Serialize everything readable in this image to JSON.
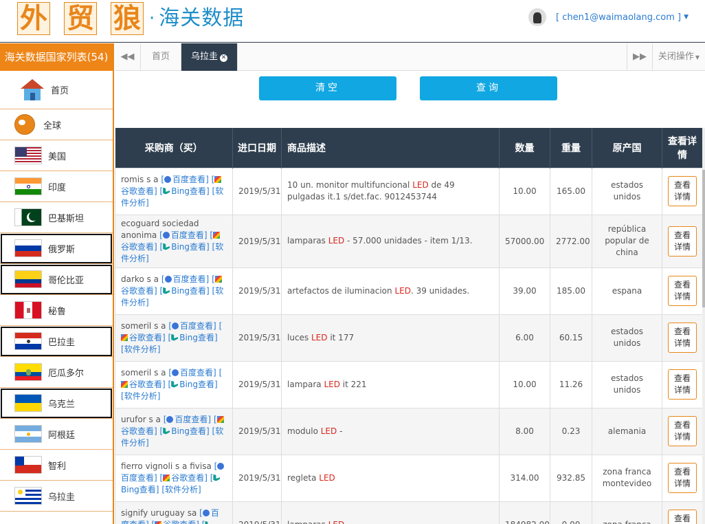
{
  "header": {
    "logo_chars": [
      "外",
      "贸",
      "狼"
    ],
    "logo_dot": "·",
    "logo_sub": "海关数据",
    "user_email": "[ chen1@waimaolang.com ]"
  },
  "sidebar": {
    "title": "海关数据国家列表(54)",
    "home": "首页",
    "global": "全球",
    "countries": [
      {
        "label": "美国",
        "flag": "us",
        "boxed": false
      },
      {
        "label": "印度",
        "flag": "in",
        "boxed": false
      },
      {
        "label": "巴基斯坦",
        "flag": "pk",
        "boxed": false
      },
      {
        "label": "俄罗斯",
        "flag": "ru",
        "boxed": true
      },
      {
        "label": "哥伦比亚",
        "flag": "co",
        "boxed": true
      },
      {
        "label": "秘鲁",
        "flag": "pe",
        "boxed": false
      },
      {
        "label": "巴拉圭",
        "flag": "py",
        "boxed": true
      },
      {
        "label": "厄瓜多尔",
        "flag": "ec",
        "boxed": false
      },
      {
        "label": "乌克兰",
        "flag": "ua",
        "boxed": true
      },
      {
        "label": "阿根廷",
        "flag": "ar",
        "boxed": false
      },
      {
        "label": "智利",
        "flag": "cl",
        "boxed": false
      },
      {
        "label": "乌拉圭",
        "flag": "uy",
        "boxed": false
      }
    ]
  },
  "tabs": {
    "back": "◀◀",
    "home": "首页",
    "active": "乌拉圭",
    "forward": "▶▶",
    "close_ops": "关闭操作"
  },
  "buttons": {
    "clear": "清空",
    "query": "查询"
  },
  "table": {
    "headers": [
      "采购商（买）",
      "进口日期",
      "商品描述",
      "数量",
      "重量",
      "原产国",
      "查看详情"
    ],
    "link_baidu": "百度查看",
    "link_google": "谷歌查看",
    "link_bing": "Bing查看",
    "link_analysis": "软件分析",
    "detail_label": "查看详情",
    "rows": [
      {
        "buyer": "romis s a",
        "date": "2019/5/31",
        "desc_pre": "10 un. monitor multifuncional ",
        "desc_hl": "LED",
        "desc_post": " de 49 pulgadas it.1 s/det.fac. 9012453744",
        "qty": "10.00",
        "weight": "165.00",
        "origin": "estados unidos"
      },
      {
        "buyer": "ecoguard sociedad anonima",
        "date": "2019/5/31",
        "desc_pre": "lamparas ",
        "desc_hl": "LED",
        "desc_post": " - 57.000 unidades - item 1/13.",
        "qty": "57000.00",
        "weight": "2772.00",
        "origin": "república popular de china"
      },
      {
        "buyer": "darko s a",
        "date": "2019/5/31",
        "desc_pre": "artefactos de iluminacion ",
        "desc_hl": "LED",
        "desc_post": ". 39 unidades.",
        "qty": "39.00",
        "weight": "185.00",
        "origin": "espana"
      },
      {
        "buyer": "someril s a",
        "date": "2019/5/31",
        "desc_pre": "luces ",
        "desc_hl": "LED",
        "desc_post": " it 177",
        "qty": "6.00",
        "weight": "60.15",
        "origin": "estados unidos"
      },
      {
        "buyer": "someril s a",
        "date": "2019/5/31",
        "desc_pre": "lampara ",
        "desc_hl": "LED",
        "desc_post": " it 221",
        "qty": "10.00",
        "weight": "11.26",
        "origin": "estados unidos"
      },
      {
        "buyer": "urufor s a",
        "date": "2019/5/31",
        "desc_pre": "modulo ",
        "desc_hl": "LED",
        "desc_post": " -",
        "qty": "8.00",
        "weight": "0.23",
        "origin": "alemania"
      },
      {
        "buyer": "fierro vignoli s a fivisa",
        "date": "2019/5/31",
        "desc_pre": "regleta ",
        "desc_hl": "LED",
        "desc_post": "",
        "qty": "314.00",
        "weight": "932.85",
        "origin": "zona franca montevideo"
      },
      {
        "buyer": "signify uruguay sa",
        "date": "2019/5/31",
        "desc_pre": "lamparas ",
        "desc_hl": "LED",
        "desc_post": "",
        "qty": "184982.00",
        "weight": "0.00",
        "origin": "zona franca"
      }
    ]
  }
}
